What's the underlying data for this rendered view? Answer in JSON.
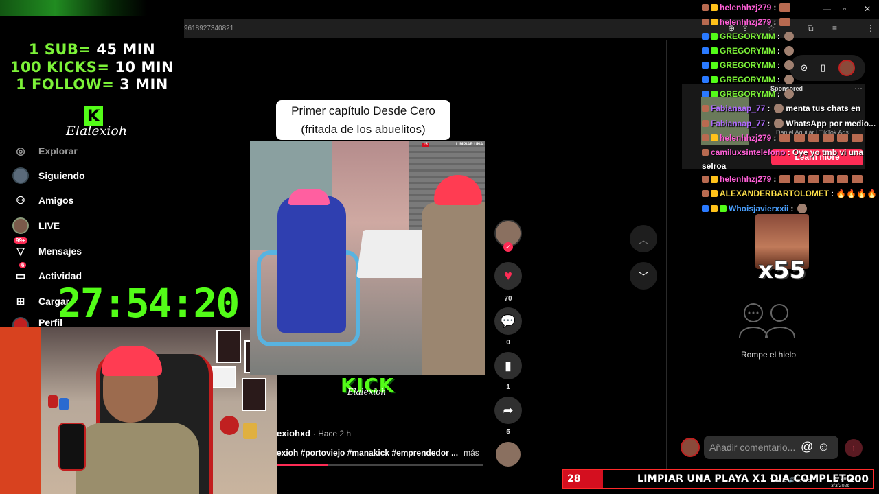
{
  "browser": {
    "url_fragment": "96189273408​21",
    "window_controls": [
      "—",
      "▫",
      "✕"
    ]
  },
  "overlay": {
    "goals": [
      {
        "label": "1 SUB=",
        "value": "45 MIN"
      },
      {
        "label": "100 KICKS=",
        "value": "10 MIN"
      },
      {
        "label": "1 FOLLOW=",
        "value": "3 MIN"
      }
    ],
    "brand_logo": "K",
    "brand_name": "Elalexioh",
    "timer": "27:54:20"
  },
  "sidebar": {
    "items": [
      {
        "label": "Explorar",
        "icon": "compass-icon"
      },
      {
        "label": "Siguiendo",
        "icon": "avatar"
      },
      {
        "label": "Amigos",
        "icon": "people-icon"
      },
      {
        "label": "LIVE",
        "icon": "live-icon"
      },
      {
        "label": "Mensajes",
        "icon": "message-icon",
        "badge": "99+"
      },
      {
        "label": "Actividad",
        "icon": "activity-icon",
        "badge": "6"
      },
      {
        "label": "Cargar",
        "icon": "upload-icon"
      },
      {
        "label": "Perfil",
        "icon": "avatar"
      }
    ]
  },
  "video": {
    "caption_line1": "Primer capítulo Desde Cero",
    "caption_line2": "(fritada de los abuelitos)",
    "corner_tag_num": "15",
    "corner_tag_text": "LIMPIAR UNA",
    "watermark": "KICK",
    "watermark_sub": "Elalexioh",
    "author": "exiohxd",
    "time": "· Hace 2 h",
    "hashtags": "exioh #portoviejo #manakick #emprendedor ...",
    "more": "más",
    "progress_fraction": 0.25
  },
  "actions": {
    "likes": "70",
    "comments": "0",
    "saves": "1",
    "shares": "5"
  },
  "chat": [
    {
      "user": "helenhhzj279",
      "sep": " :",
      "msg": "",
      "class": "user-pink",
      "badges": [
        "#b86a50",
        "#ffc21a"
      ],
      "emotes": 1
    },
    {
      "user": "helenhhzj279",
      "sep": " :",
      "msg": "",
      "class": "user-pink",
      "badges": [
        "#b86a50",
        "#ffc21a"
      ],
      "emotes": 1
    },
    {
      "user": "GREGORYMM",
      "sep": " :",
      "msg": "",
      "class": "user-green",
      "badges": [
        "#2a7aff",
        "#53fc18"
      ],
      "emotes": 0,
      "face": true
    },
    {
      "user": "GREGORYMM",
      "sep": " :",
      "msg": "",
      "class": "user-green",
      "badges": [
        "#2a7aff",
        "#53fc18"
      ],
      "emotes": 0,
      "face": true
    },
    {
      "user": "GREGORYMM",
      "sep": " :",
      "msg": "",
      "class": "user-green",
      "badges": [
        "#2a7aff",
        "#53fc18"
      ],
      "emotes": 0,
      "face": true
    },
    {
      "user": "GREGORYMM",
      "sep": " :",
      "msg": "",
      "class": "user-green",
      "badges": [
        "#2a7aff",
        "#53fc18"
      ],
      "emotes": 0,
      "face": true
    },
    {
      "user": "GREGORYMM",
      "sep": " :",
      "msg": "",
      "class": "user-green",
      "badges": [
        "#2a7aff",
        "#53fc18"
      ],
      "emotes": 0,
      "face": true
    },
    {
      "user": "Fabianaap_77",
      "sep": " :",
      "msg": "menta tus chats en",
      "class": "user-purple",
      "badges": [
        "#b86a50"
      ],
      "emotes": 0,
      "face": true
    },
    {
      "user": "Fabianaap_77",
      "sep": " :",
      "msg": "WhatsApp por medio...",
      "class": "user-purple",
      "badges": [
        "#b86a50"
      ],
      "emotes": 0,
      "face": true
    },
    {
      "user": "helenhhzj279",
      "sep": " :",
      "msg": "",
      "class": "user-pink",
      "badges": [
        "#b86a50",
        "#ffc21a"
      ],
      "emotes": 6
    },
    {
      "user": "camiluxsintelefono",
      "sep": " :",
      "msg": "Oye yo tmb vi una",
      "class": "user-pink",
      "badges": [
        "#b86a50"
      ],
      "emotes": 0
    },
    {
      "user": "",
      "sep": "",
      "msg": "selroa",
      "class": "user-white",
      "badges": [],
      "emotes": 0
    },
    {
      "user": "helenhhzj279",
      "sep": " :",
      "msg": "",
      "class": "user-pink",
      "badges": [
        "#b86a50",
        "#ffc21a"
      ],
      "emotes": 6
    },
    {
      "user": "ALEXANDERBARTOLOMET",
      "sep": " :",
      "msg": "🔥🔥🔥🔥",
      "class": "user-yellow",
      "badges": [
        "#b86a50",
        "#ffc21a"
      ],
      "emotes": 0
    },
    {
      "user": "Whoisjavierxxii",
      "sep": " :",
      "msg": "",
      "class": "user-blue",
      "badges": [
        "#2a7aff",
        "#ffc21a",
        "#53fc18"
      ],
      "emotes": 0,
      "face": true
    }
  ],
  "ad": {
    "sponsored": "Sponsored",
    "advertiser": "Daniel Aguilár | TikTok Ads",
    "cta": "Learn more"
  },
  "emote_multiplier": "x55",
  "empty_state": "Rompe el hielo",
  "comment_input": {
    "placeholder": "Añadir comentario..."
  },
  "goal_bar": {
    "count": "28",
    "text": "LIMPIAR UNA PLAYA X1 DIA COMPLETO",
    "total": "200"
  },
  "taskbar": {
    "lang": "ESP",
    "time": "22:46",
    "date": "3/3/2026"
  }
}
